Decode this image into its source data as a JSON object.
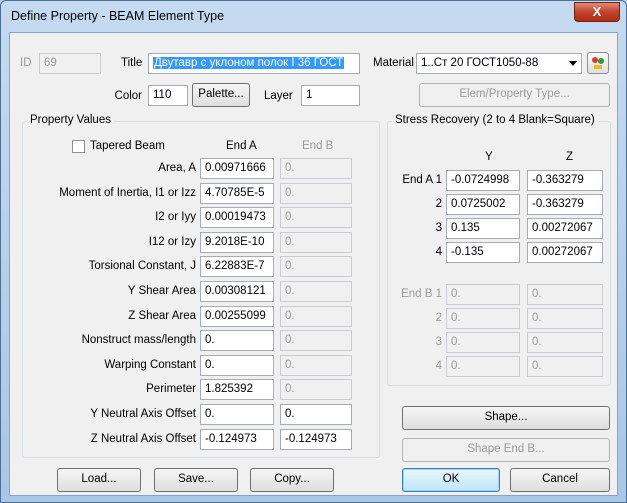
{
  "window": {
    "title": "Define Property - BEAM Element Type",
    "close_glyph": "X"
  },
  "top": {
    "id_label": "ID",
    "id_value": "69",
    "title_label": "Title",
    "title_value": "Двутавр с уклоном полок I 36 ГОСТ",
    "material_label": "Material",
    "material_value": "1..Ст 20  ГОСТ1050-88",
    "color_label": "Color",
    "color_value": "110",
    "palette_button": "Palette...",
    "layer_label": "Layer",
    "layer_value": "1",
    "elem_type_button": "Elem/Property Type..."
  },
  "property_values": {
    "group_title": "Property Values",
    "tapered_label": "Tapered Beam",
    "tapered_checked": false,
    "end_a_header": "End A",
    "end_b_header": "End B",
    "rows": [
      {
        "label": "Area, A",
        "end_a": "0.00971666",
        "end_b": "0."
      },
      {
        "label": "Moment of Inertia, I1 or Izz",
        "end_a": "4.70785E-5",
        "end_b": "0."
      },
      {
        "label": "I2 or Iyy",
        "end_a": "0.00019473",
        "end_b": "0."
      },
      {
        "label": "I12 or Izy",
        "end_a": "9.2018E-10",
        "end_b": "0."
      },
      {
        "label": "Torsional Constant, J",
        "end_a": "6.22883E-7",
        "end_b": "0."
      },
      {
        "label": "Y Shear Area",
        "end_a": "0.00308121",
        "end_b": "0."
      },
      {
        "label": "Z Shear Area",
        "end_a": "0.00255099",
        "end_b": "0."
      },
      {
        "label": "Nonstruct mass/length",
        "end_a": "0.",
        "end_b": "0."
      },
      {
        "label": "Warping Constant",
        "end_a": "0.",
        "end_b": "0."
      },
      {
        "label": "Perimeter",
        "end_a": "1.825392",
        "end_b": "0."
      },
      {
        "label": "Y Neutral Axis Offset",
        "end_a": "0.",
        "end_b": "0."
      },
      {
        "label": "Z Neutral Axis Offset",
        "end_a": "-0.124973",
        "end_b": "-0.124973"
      }
    ]
  },
  "stress_recovery": {
    "group_title": "Stress Recovery (2 to 4 Blank=Square)",
    "y_header": "Y",
    "z_header": "Z",
    "end_a_rows": [
      {
        "label": "End A 1",
        "y": "-0.0724998",
        "z": "-0.363279"
      },
      {
        "label": "2",
        "y": "0.0725002",
        "z": "-0.363279"
      },
      {
        "label": "3",
        "y": "0.135",
        "z": "0.00272067"
      },
      {
        "label": "4",
        "y": "-0.135",
        "z": "0.00272067"
      }
    ],
    "end_b_rows": [
      {
        "label": "End B 1",
        "y": "0.",
        "z": "0."
      },
      {
        "label": "2",
        "y": "0.",
        "z": "0."
      },
      {
        "label": "3",
        "y": "0.",
        "z": "0."
      },
      {
        "label": "4",
        "y": "0.",
        "z": "0."
      }
    ],
    "shape_button": "Shape...",
    "shape_end_b_button": "Shape End B..."
  },
  "buttons": {
    "load": "Load...",
    "save": "Save...",
    "copy": "Copy...",
    "ok": "OK",
    "cancel": "Cancel"
  }
}
